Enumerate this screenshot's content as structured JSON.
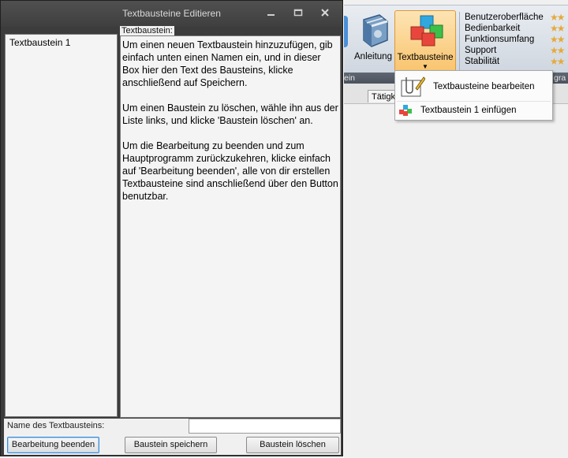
{
  "dialog": {
    "title": "Textbausteine Editieren",
    "list": {
      "items": [
        "Textbaustein 1"
      ]
    },
    "editor": {
      "label": "Textbaustein:",
      "paragraphs": [
        "Um einen neuen Textbaustein hinzuzufügen, gib einfach unten einen Namen ein, und in dieser Box hier den Text des Bausteins, klicke anschließend auf Speichern.",
        "Um einen Baustein zu löschen, wähle ihn aus der Liste links, und klicke 'Baustein löschen' an.",
        "Um die Bearbeitung zu beenden und zum Hauptprogramm zurückzukehren, klicke einfach auf 'Bearbeitung beenden', alle von dir erstellen Textbausteine sind anschließend über den Button benutzbar."
      ]
    },
    "name_field": {
      "label": "Name des Textbausteins:",
      "value": ""
    },
    "buttons": {
      "end": "Bearbeitung beenden",
      "save": "Baustein speichern",
      "delete": "Baustein löschen"
    }
  },
  "ribbon": {
    "anleitung_label": "Anleitung",
    "textbausteine_label": "Textbausteine",
    "rating_items": [
      "Benutzeroberfläche",
      "Bedienbarkeit",
      "Funktionsumfang",
      "Support",
      "Stabilität"
    ],
    "group_left": "ein",
    "group_right": "gra",
    "tab_stub": "Tätigk"
  },
  "dropdown": {
    "items": [
      "Textbausteine bearbeiten",
      "Textbaustein 1 einfügen"
    ]
  },
  "colors": {
    "window_frame": "#3c3c3c",
    "ribbon_active": "#f9c46d",
    "star": "#e6a93a",
    "focus_border": "#3b8ad8"
  }
}
